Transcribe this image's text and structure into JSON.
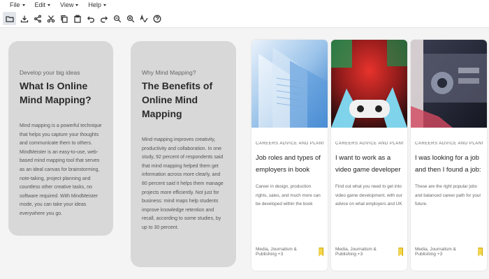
{
  "menu": [
    {
      "label": "File"
    },
    {
      "label": "Edit"
    },
    {
      "label": "View"
    },
    {
      "label": "Help"
    }
  ],
  "toolbar": [
    "folder-icon",
    "download-icon",
    "share-icon",
    "cut-icon",
    "copy-icon",
    "paste-icon",
    "undo-icon",
    "redo-icon",
    "zoom-out-icon",
    "zoom-in-icon",
    "spellcheck-icon",
    "help-icon"
  ],
  "panels": [
    {
      "kicker": "Develop your big ideas",
      "title": "What Is Online Mind Mapping?",
      "body": "Mind mapping is a powerful technique that helps you capture your thoughts and communicate them to others. MindMeister is an easy-to-use, web-based mind mapping tool that serves as an ideal canvas for brainstorming, note-taking, project planning and countless other creative tasks, no software required. With MindMeister mode, you can take your ideas everywhere you go."
    },
    {
      "kicker": "Why Mind Mapping?",
      "title": "The Benefits of Online Mind Mapping",
      "body": "Mind mapping improves creativity, productivity and collaboration. In one study, 92 percent of respondents said that mind mapping helped them get information across more clearly, and 80 percent said it helps them manage projects more efficiently. Not just for business: mind maps help students improve knowledge retention and recall, according to some studies, by up to 30 percent."
    }
  ],
  "articles": [
    {
      "category": "CAREERS ADVICE AND PLANNING",
      "title": "Job roles and types of employers in book publishing",
      "blurb": "Career in design, production rights, sales, and much more can be developed within the book publishing world. We explain what each role involves.",
      "author": "Media, Journalism & Publishing +3"
    },
    {
      "category": "CAREERS ADVICE AND PLANNING",
      "title": "I want to work as a video game developer - but I can't get a job in the industry",
      "blurb": "Find out what you need to get into video game development, with our advice on what employers and UK game development studios expect.",
      "author": "Media, Journalism & Publishing +3"
    },
    {
      "category": "CAREERS ADVICE AND PLANNING",
      "title": "I was looking for a job and then I found a job: make your work on your terms",
      "blurb": "These are the right popular jobs and balanced career path for your future.",
      "author": "Media, Journalism & Publishing +3"
    }
  ],
  "colors": {
    "panel_bg": "#d8d8d8",
    "page_bg": "#f4f4f4",
    "bookmark": "#f5d54a"
  }
}
